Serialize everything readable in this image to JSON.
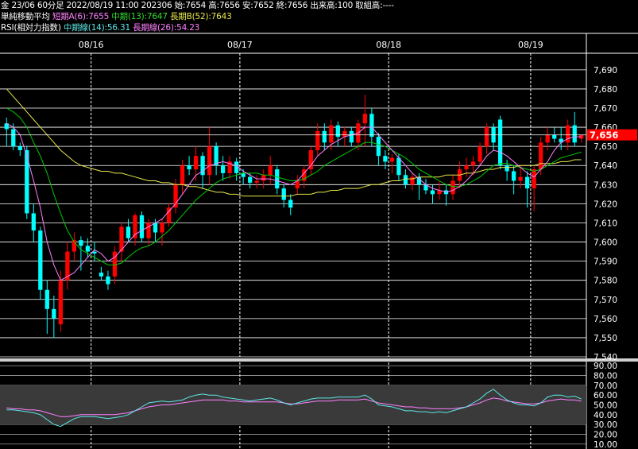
{
  "header": {
    "line1": "金 23/06 60分足 2022/08/19 11:00 202306 始:7654 高:7656 安:7652 終:7656 出来高:100 取組高:----",
    "ma_title": "単純移動平均",
    "ma_short": "短期A(6):7655",
    "ma_mid": "中期(13):7647",
    "ma_long": "長期B(52):7643",
    "rsi_title": "RSI(相対力指数)",
    "rsi_mid": "中期線(14):56.31",
    "rsi_long": "長期線(26):54.23"
  },
  "colors": {
    "up": "#ff0000",
    "down": "#00ffff",
    "ma_short": "#ff80ff",
    "ma_mid": "#00cc00",
    "ma_long": "#e8e84a",
    "rsi_mid": "#5fe8e8",
    "rsi_long": "#ff80ff",
    "current": "#ff0000",
    "grid": "#ffffff"
  },
  "chart_data": [
    {
      "type": "candlestick",
      "title": "",
      "x_labels": [
        "08/16",
        "08/17",
        "08/18",
        "08/19"
      ],
      "yticks": [
        "7,690",
        "7,680",
        "7,670",
        "7,660",
        "7,650",
        "7,640",
        "7,630",
        "7,620",
        "7,610",
        "7,600",
        "7,590",
        "7,580",
        "7,570",
        "7,560",
        "7,550",
        "7,540"
      ],
      "ylim": [
        7540,
        7697
      ],
      "current_label": "7,656",
      "current_value": 7656,
      "ohlc": [
        [
          7662,
          7665,
          7650,
          7659
        ],
        [
          7659,
          7662,
          7648,
          7650
        ],
        [
          7650,
          7652,
          7645,
          7648
        ],
        [
          7648,
          7650,
          7612,
          7615
        ],
        [
          7615,
          7620,
          7600,
          7606
        ],
        [
          7606,
          7608,
          7570,
          7575
        ],
        [
          7575,
          7580,
          7552,
          7565
        ],
        [
          7565,
          7572,
          7550,
          7560
        ],
        [
          7557,
          7585,
          7553,
          7580
        ],
        [
          7580,
          7600,
          7575,
          7595
        ],
        [
          7595,
          7605,
          7590,
          7601
        ],
        [
          7601,
          7603,
          7585,
          7598
        ],
        [
          7598,
          7602,
          7592,
          7595
        ],
        [
          7595,
          7600,
          7590,
          7594
        ],
        [
          7584,
          7587,
          7580,
          7582
        ],
        [
          7582,
          7585,
          7575,
          7578
        ],
        [
          7582,
          7598,
          7578,
          7595
        ],
        [
          7595,
          7610,
          7590,
          7608
        ],
        [
          7608,
          7612,
          7600,
          7602
        ],
        [
          7602,
          7615,
          7598,
          7614
        ],
        [
          7614,
          7616,
          7600,
          7602
        ],
        [
          7602,
          7612,
          7598,
          7610
        ],
        [
          7610,
          7612,
          7600,
          7605
        ],
        [
          7605,
          7612,
          7598,
          7610
        ],
        [
          7610,
          7620,
          7608,
          7618
        ],
        [
          7618,
          7633,
          7615,
          7630
        ],
        [
          7630,
          7643,
          7625,
          7640
        ],
        [
          7640,
          7645,
          7635,
          7638
        ],
        [
          7638,
          7650,
          7632,
          7645
        ],
        [
          7645,
          7647,
          7628,
          7635
        ],
        [
          7635,
          7660,
          7630,
          7650
        ],
        [
          7650,
          7652,
          7635,
          7640
        ],
        [
          7640,
          7645,
          7632,
          7636
        ],
        [
          7636,
          7645,
          7633,
          7642
        ],
        [
          7642,
          7644,
          7632,
          7636
        ],
        [
          7636,
          7638,
          7630,
          7634
        ],
        [
          7634,
          7636,
          7628,
          7631
        ],
        [
          7631,
          7635,
          7628,
          7632
        ],
        [
          7632,
          7638,
          7628,
          7635
        ],
        [
          7635,
          7645,
          7630,
          7640
        ],
        [
          7638,
          7640,
          7625,
          7628
        ],
        [
          7628,
          7630,
          7618,
          7622
        ],
        [
          7622,
          7625,
          7614,
          7618
        ],
        [
          7628,
          7635,
          7625,
          7632
        ],
        [
          7632,
          7640,
          7628,
          7638
        ],
        [
          7638,
          7650,
          7635,
          7648
        ],
        [
          7648,
          7662,
          7645,
          7658
        ],
        [
          7658,
          7662,
          7648,
          7652
        ],
        [
          7652,
          7664,
          7648,
          7661
        ],
        [
          7661,
          7663,
          7650,
          7655
        ],
        [
          7655,
          7660,
          7650,
          7658
        ],
        [
          7658,
          7660,
          7650,
          7652
        ],
        [
          7652,
          7664,
          7648,
          7662
        ],
        [
          7662,
          7677,
          7650,
          7667
        ],
        [
          7667,
          7670,
          7650,
          7655
        ],
        [
          7655,
          7657,
          7640,
          7645
        ],
        [
          7645,
          7648,
          7638,
          7642
        ],
        [
          7642,
          7646,
          7636,
          7644
        ],
        [
          7644,
          7646,
          7632,
          7635
        ],
        [
          7635,
          7638,
          7628,
          7630
        ],
        [
          7630,
          7636,
          7627,
          7634
        ],
        [
          7634,
          7636,
          7622,
          7630
        ],
        [
          7630,
          7633,
          7625,
          7627
        ],
        [
          7627,
          7630,
          7620,
          7625
        ],
        [
          7625,
          7632,
          7622,
          7627
        ],
        [
          7627,
          7630,
          7619,
          7625
        ],
        [
          7625,
          7635,
          7622,
          7632
        ],
        [
          7632,
          7642,
          7628,
          7638
        ],
        [
          7638,
          7644,
          7634,
          7640
        ],
        [
          7640,
          7645,
          7635,
          7642
        ],
        [
          7642,
          7652,
          7640,
          7650
        ],
        [
          7650,
          7662,
          7646,
          7660
        ],
        [
          7660,
          7662,
          7648,
          7652
        ],
        [
          7664,
          7666,
          7638,
          7640
        ],
        [
          7640,
          7643,
          7632,
          7637
        ],
        [
          7637,
          7640,
          7625,
          7632
        ],
        [
          7632,
          7640,
          7628,
          7634
        ],
        [
          7634,
          7637,
          7618,
          7628
        ],
        [
          7628,
          7640,
          7616,
          7638
        ],
        [
          7638,
          7655,
          7635,
          7652
        ],
        [
          7652,
          7660,
          7648,
          7656
        ],
        [
          7656,
          7660,
          7652,
          7654
        ],
        [
          7654,
          7660,
          7648,
          7652
        ],
        [
          7652,
          7664,
          7648,
          7661
        ],
        [
          7661,
          7668,
          7650,
          7652
        ],
        [
          7654,
          7656,
          7652,
          7656
        ]
      ],
      "ma_short": [
        7662,
        7660,
        7656,
        7645,
        7632,
        7618,
        7600,
        7588,
        7580,
        7582,
        7584,
        7588,
        7592,
        7596,
        7594,
        7590,
        7592,
        7596,
        7600,
        7604,
        7606,
        7608,
        7610,
        7612,
        7616,
        7620,
        7625,
        7630,
        7635,
        7637,
        7640,
        7641,
        7642,
        7641,
        7640,
        7637,
        7635,
        7633,
        7633,
        7633,
        7632,
        7631,
        7630,
        7632,
        7636,
        7640,
        7645,
        7648,
        7651,
        7653,
        7655,
        7656,
        7657,
        7660,
        7660,
        7656,
        7652,
        7648,
        7644,
        7640,
        7636,
        7633,
        7630,
        7628,
        7627,
        7626,
        7627,
        7629,
        7632,
        7636,
        7640,
        7645,
        7648,
        7647,
        7645,
        7642,
        7639,
        7636,
        7634,
        7638,
        7642,
        7648,
        7652,
        7654,
        7655,
        7655
      ],
      "ma_mid": [
        7670,
        7668,
        7665,
        7660,
        7652,
        7645,
        7636,
        7625,
        7615,
        7606,
        7600,
        7596,
        7594,
        7592,
        7590,
        7588,
        7588,
        7589,
        7592,
        7595,
        7597,
        7598,
        7600,
        7603,
        7606,
        7610,
        7614,
        7618,
        7622,
        7625,
        7628,
        7631,
        7633,
        7634,
        7635,
        7636,
        7636,
        7636,
        7635,
        7635,
        7634,
        7633,
        7632,
        7632,
        7633,
        7635,
        7637,
        7640,
        7642,
        7644,
        7646,
        7648,
        7650,
        7652,
        7652,
        7651,
        7650,
        7648,
        7646,
        7644,
        7641,
        7638,
        7636,
        7634,
        7632,
        7630,
        7629,
        7629,
        7630,
        7632,
        7634,
        7637,
        7640,
        7641,
        7641,
        7640,
        7639,
        7638,
        7637,
        7638,
        7640,
        7642,
        7644,
        7645,
        7646,
        7647
      ],
      "ma_long": [
        7680,
        7676,
        7672,
        7668,
        7664,
        7660,
        7656,
        7652,
        7648,
        7645,
        7642,
        7640,
        7639,
        7638,
        7637,
        7637,
        7636,
        7636,
        7635,
        7634,
        7633,
        7632,
        7632,
        7631,
        7631,
        7630,
        7630,
        7629,
        7629,
        7628,
        7627,
        7626,
        7626,
        7625,
        7625,
        7624,
        7624,
        7624,
        7624,
        7624,
        7624,
        7624,
        7624,
        7625,
        7625,
        7625,
        7626,
        7626,
        7627,
        7627,
        7628,
        7628,
        7628,
        7629,
        7630,
        7630,
        7631,
        7632,
        7632,
        7633,
        7633,
        7634,
        7634,
        7634,
        7634,
        7635,
        7635,
        7635,
        7636,
        7636,
        7637,
        7638,
        7638,
        7639,
        7639,
        7639,
        7640,
        7640,
        7640,
        7641,
        7641,
        7641,
        7642,
        7642,
        7643,
        7643
      ]
    },
    {
      "type": "line",
      "title": "",
      "yticks": [
        "90.00",
        "80.00",
        "70.00",
        "60.00",
        "50.00",
        "40.00",
        "30.00",
        "20.00",
        "10.00"
      ],
      "ylim": [
        5,
        95
      ],
      "bands": [
        [
          30,
          70
        ]
      ],
      "rsi_mid": [
        45,
        45,
        44,
        43,
        42,
        40,
        35,
        30,
        28,
        32,
        36,
        38,
        38,
        38,
        37,
        36,
        37,
        38,
        40,
        44,
        48,
        52,
        53,
        54,
        53,
        54,
        55,
        58,
        60,
        61,
        60,
        60,
        58,
        57,
        56,
        55,
        54,
        55,
        56,
        57,
        55,
        52,
        50,
        52,
        54,
        56,
        57,
        57,
        57,
        58,
        58,
        58,
        58,
        60,
        56,
        50,
        49,
        48,
        46,
        44,
        44,
        43,
        43,
        42,
        43,
        42,
        44,
        46,
        48,
        52,
        56,
        62,
        66,
        60,
        55,
        52,
        50,
        50,
        49,
        52,
        58,
        60,
        60,
        58,
        59,
        56
      ],
      "rsi_long": [
        47,
        46,
        46,
        45,
        45,
        44,
        42,
        40,
        38,
        38,
        39,
        40,
        40,
        40,
        40,
        40,
        40,
        41,
        42,
        44,
        46,
        48,
        49,
        50,
        50,
        51,
        52,
        53,
        54,
        55,
        55,
        55,
        55,
        54,
        54,
        53,
        53,
        53,
        53,
        53,
        53,
        52,
        51,
        51,
        52,
        53,
        54,
        54,
        54,
        55,
        55,
        55,
        55,
        56,
        54,
        52,
        51,
        50,
        49,
        48,
        48,
        47,
        47,
        46,
        46,
        46,
        46,
        47,
        48,
        50,
        52,
        55,
        57,
        56,
        54,
        53,
        52,
        51,
        51,
        52,
        54,
        55,
        56,
        55,
        55,
        54
      ]
    }
  ]
}
